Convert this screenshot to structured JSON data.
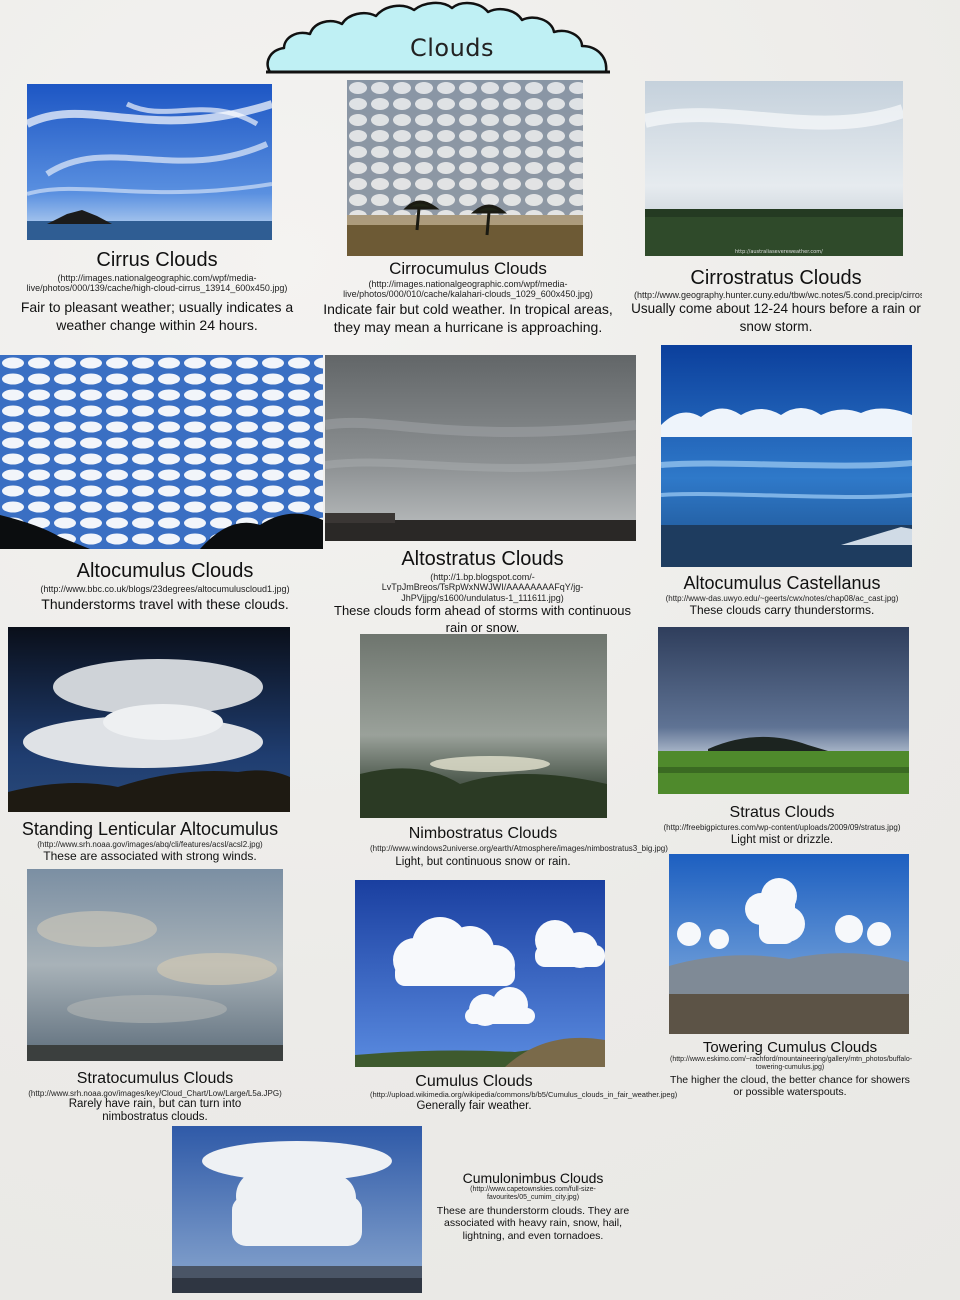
{
  "header": {
    "title": "Clouds",
    "banner_color": "#bff0f4"
  },
  "clouds": [
    {
      "name": "Cirrus Clouds",
      "url": "(http://images.nationalgeographic.com/wpf/media-live/photos/000/139/cache/high-cloud-cirrus_13914_600x450.jpg)",
      "description": "Fair to pleasant weather; usually indicates a weather change within 24 hours."
    },
    {
      "name": "Cirrocumulus Clouds",
      "url": "(http://images.nationalgeographic.com/wpf/media-live/photos/000/010/cache/kalahari-clouds_1029_600x450.jpg)",
      "description": "Indicate fair but cold weather. In tropical areas, they may mean a hurricane is approaching."
    },
    {
      "name": "Cirrostratus Clouds",
      "url": "(http://www.geography.hunter.cuny.edu/tbw/wc.notes/5.cond.precip/cirrostratus.clouds.jpg)",
      "description": "Usually come about 12-24 hours before a rain or snow storm.",
      "photo_watermark": "http://australiasevereweather.com/"
    },
    {
      "name": "Altocumulus Clouds",
      "url": "(http://www.bbc.co.uk/blogs/23degrees/altocumuluscloud1.jpg)",
      "description": "Thunderstorms travel with these clouds."
    },
    {
      "name": "Altostratus Clouds",
      "url": "(http://1.bp.blogspot.com/-LvTpJmBreos/TsRpWxNWJWI/AAAAAAAAFqY/jg-JhPVjjpg/s1600/undulatus-1_111611.jpg)",
      "description": "These clouds form ahead of storms with continuous rain or snow."
    },
    {
      "name": "Altocumulus Castellanus",
      "url": "(http://www-das.uwyo.edu/~geerts/cwx/notes/chap08/ac_cast.jpg)",
      "description": "These clouds carry thunderstorms."
    },
    {
      "name": "Standing Lenticular Altocumulus",
      "url": "(http://www.srh.noaa.gov/images/abq/cli/features/acsl/acsl2.jpg)",
      "description": "These are associated with strong winds."
    },
    {
      "name": "Nimbostratus Clouds",
      "url": "(http://www.windows2universe.org/earth/Atmosphere/images/nimbostratus3_big.jpg)",
      "description": "Light, but continuous snow or rain."
    },
    {
      "name": "Stratus Clouds",
      "url": "(http://freebigpictures.com/wp-content/uploads/2009/09/stratus.jpg)",
      "description": "Light mist or drizzle."
    },
    {
      "name": "Stratocumulus Clouds",
      "url": "(http://www.srh.noaa.gov/images/key/Cloud_Chart/Low/Large/L5a.JPG)",
      "description": "Rarely have rain, but can turn into nimbostratus clouds."
    },
    {
      "name": "Cumulus Clouds",
      "url": "(http://upload.wikimedia.org/wikipedia/commons/b/b5/Cumulus_clouds_in_fair_weather.jpeg)",
      "description": "Generally fair weather."
    },
    {
      "name": "Towering Cumulus Clouds",
      "url": "(http://www.eskimo.com/~rachford/mountaineering/gallery/mtn_photos/buffalo-towering-cumulus.jpg)",
      "description": "The higher the cloud, the better chance for showers or possible waterspouts."
    },
    {
      "name": "Cumulonimbus Clouds",
      "url": "(http://www.capetownskies.com/full-size-favourites/05_cumim_city.jpg)",
      "description": "These are thunderstorm clouds. They are associated with heavy rain, snow, hail, lightning, and even tornadoes."
    }
  ]
}
